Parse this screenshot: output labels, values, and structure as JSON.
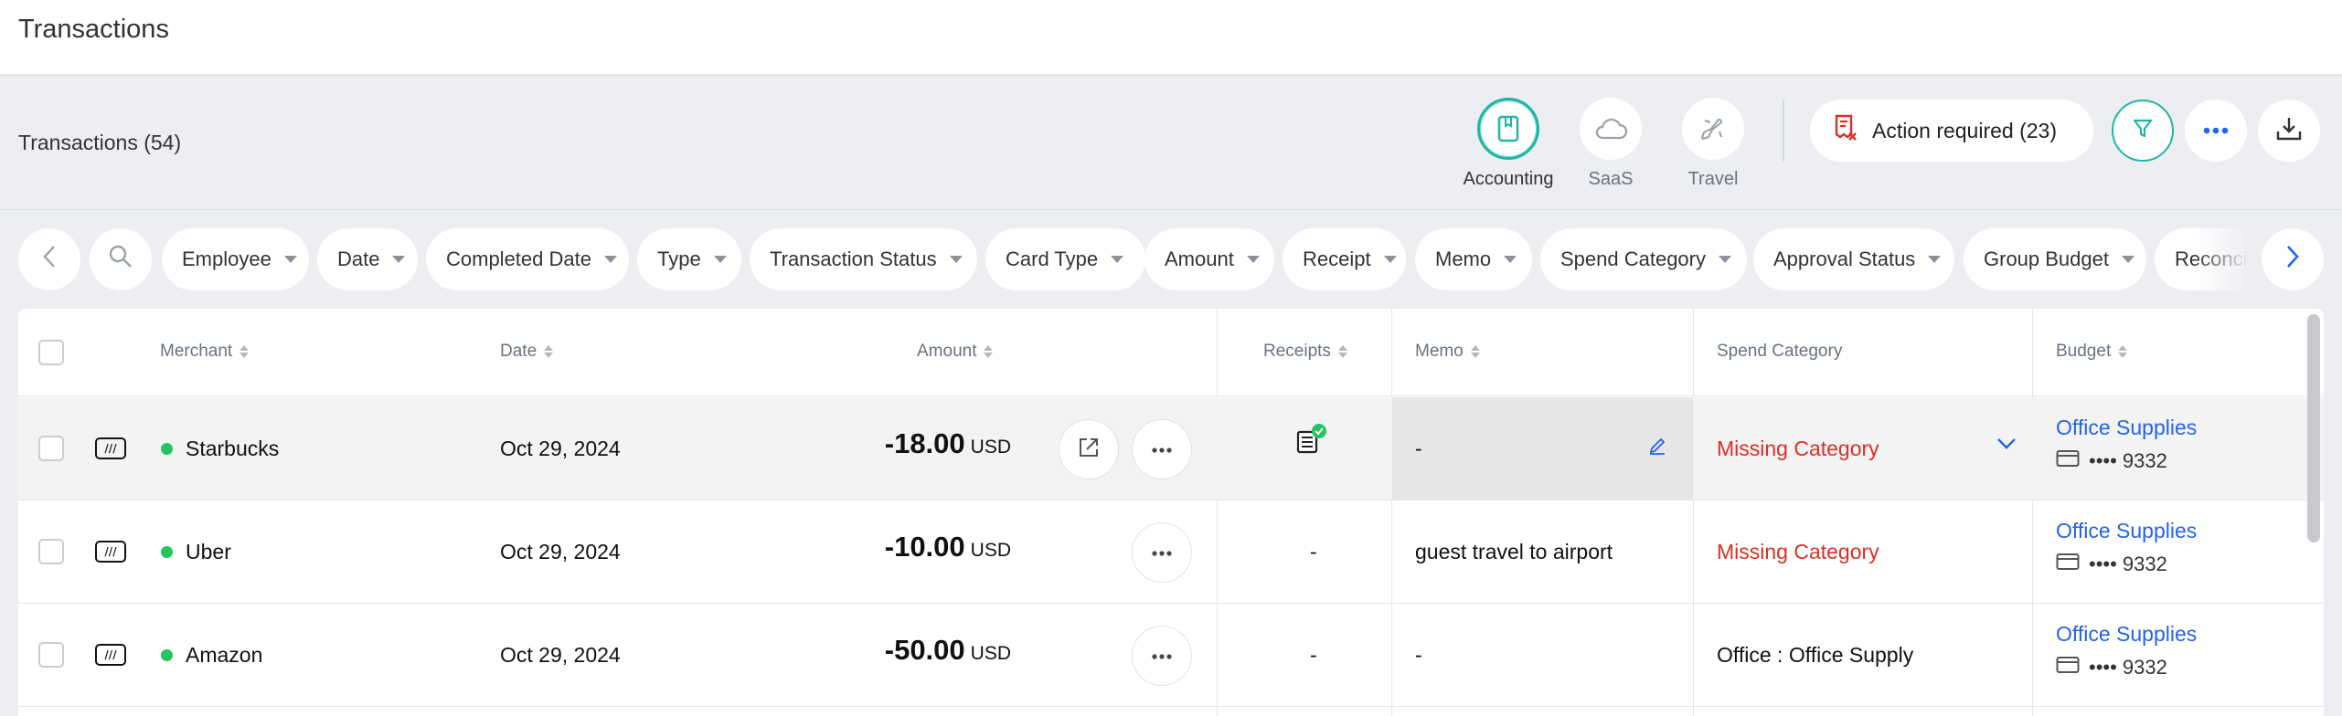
{
  "page": {
    "title": "Transactions"
  },
  "header": {
    "count_title": "Transactions (54)",
    "categories": [
      {
        "label": "Accounting",
        "icon": "book-icon",
        "active": true
      },
      {
        "label": "SaaS",
        "icon": "cloud-icon",
        "active": false
      },
      {
        "label": "Travel",
        "icon": "airplane-icon",
        "active": false
      }
    ],
    "action_required": "Action required (23)"
  },
  "filters": [
    "Employee",
    "Date",
    "Completed Date",
    "Type",
    "Transaction Status",
    "Card Type",
    "Amount",
    "Receipt",
    "Memo",
    "Spend Category",
    "Approval Status",
    "Group Budget",
    "Reconcil"
  ],
  "table": {
    "columns": {
      "merchant": "Merchant",
      "date": "Date",
      "amount": "Amount",
      "receipts": "Receipts",
      "memo": "Memo",
      "spend_category": "Spend Category",
      "budget": "Budget"
    },
    "rows": [
      {
        "merchant": "Starbucks",
        "date": "Oct 29, 2024",
        "amount": "-18.00",
        "currency": "USD",
        "receipt": "has-receipt",
        "memo": "-",
        "category": "Missing Category",
        "budget": "Office Supplies",
        "card": "•••• 9332"
      },
      {
        "merchant": "Uber",
        "date": "Oct 29, 2024",
        "amount": "-10.00",
        "currency": "USD",
        "receipt": "-",
        "memo": "guest travel to airport",
        "category": "Missing Category",
        "budget": "Office Supplies",
        "card": "•••• 9332"
      },
      {
        "merchant": "Amazon",
        "date": "Oct 29, 2024",
        "amount": "-50.00",
        "currency": "USD",
        "receipt": "-",
        "memo": "-",
        "category": "Office : Office Supply",
        "budget": "Office Supplies",
        "card": "•••• 9332"
      }
    ]
  },
  "colors": {
    "accent_teal": "#20b6a6",
    "link_blue": "#2563eb",
    "error_red": "#d93025",
    "status_green": "#22c55e"
  }
}
